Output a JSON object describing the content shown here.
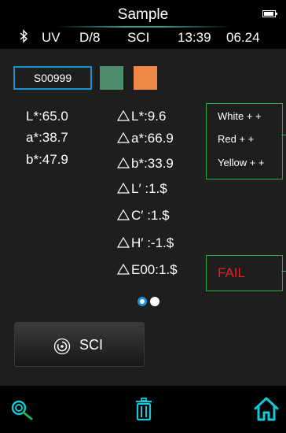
{
  "header": {
    "title": "Sample",
    "light_source": "UV",
    "geometry": "D/8",
    "mode": "SCI",
    "time": "13:39",
    "date": "06.24"
  },
  "sample": {
    "id": "S00999",
    "standard_color": "#4e8c6b",
    "sample_color": "#ef8847"
  },
  "measurements": {
    "L": "L*:65.0",
    "a": "a*:38.7",
    "b": "b*:47.9"
  },
  "differences": {
    "dL": "L*:9.6",
    "da": "a*:66.9",
    "db": "b*:33.9",
    "dL2": "L′ :1.$",
    "dC2": "C′ :1.$",
    "dH2": "H′ :-1.$",
    "dE00": "E00:1.$"
  },
  "assessment": {
    "items": [
      "White + +",
      "Red + +",
      "Yellow + +"
    ],
    "result": "FAIL"
  },
  "pager": {
    "active_page": 1,
    "page_count": 2
  },
  "sci_button": {
    "label": "SCI"
  },
  "footer": {
    "icons": [
      "search-icon",
      "trash-icon",
      "home-icon"
    ]
  },
  "colors": {
    "accent_blue": "#1a8fd1",
    "accent_green": "#2dab48",
    "fail_red": "#e41f29",
    "icon_teal": "#15c8d8"
  }
}
